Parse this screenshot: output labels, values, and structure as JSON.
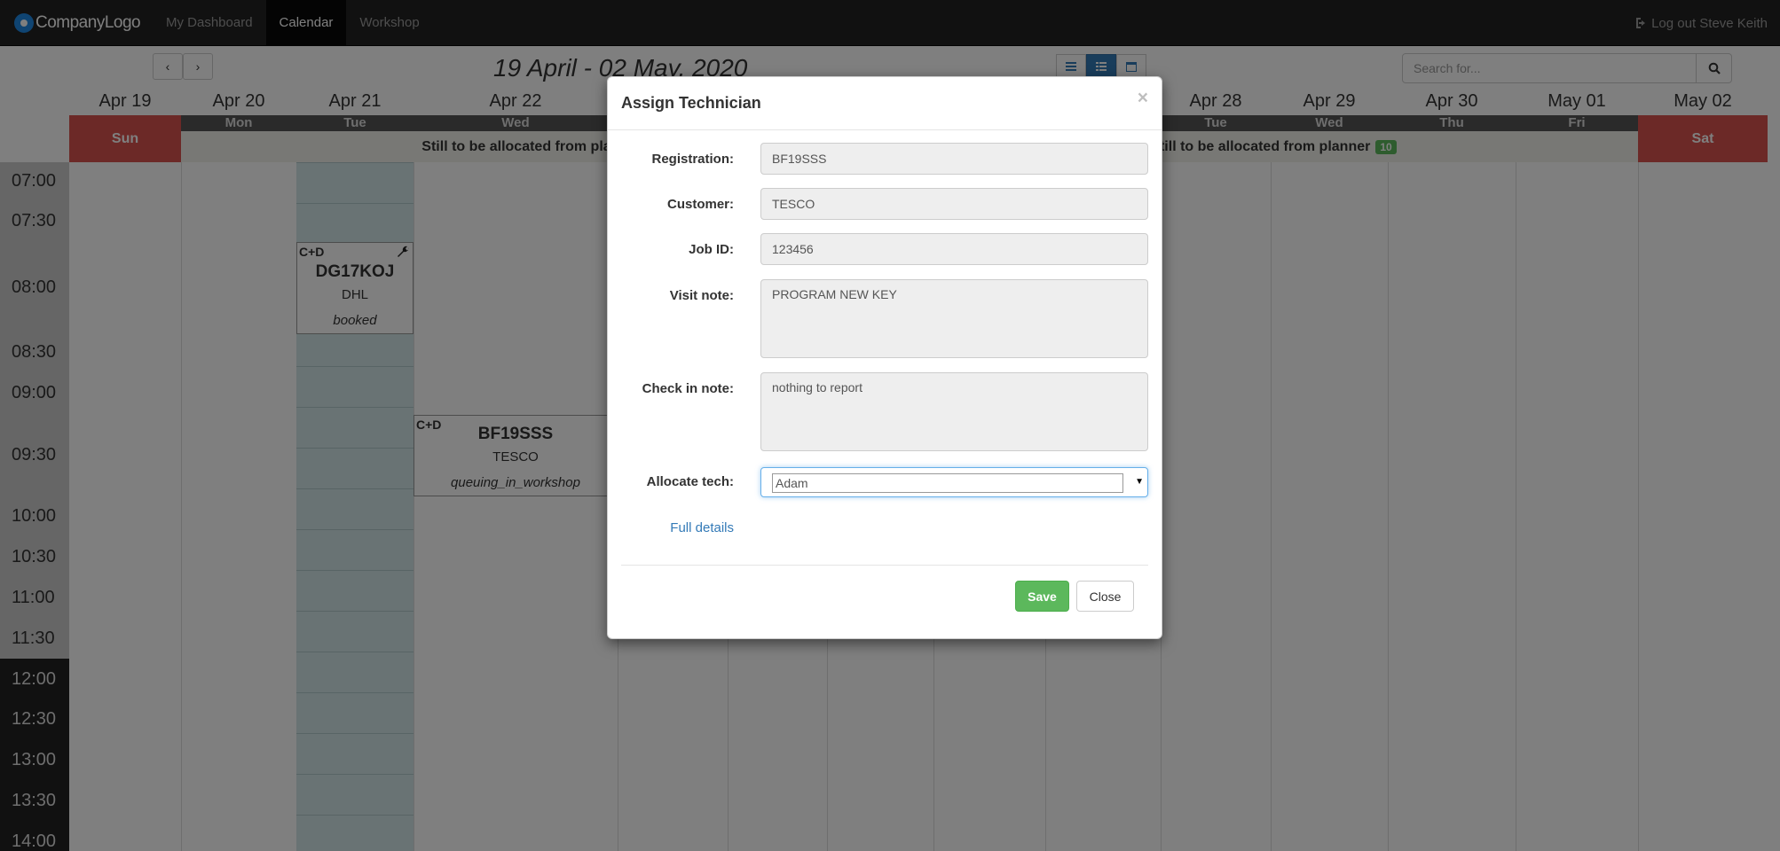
{
  "navbar": {
    "brand": "CompanyLogo",
    "items": [
      {
        "label": "My Dashboard",
        "active": false
      },
      {
        "label": "Calendar",
        "active": true
      },
      {
        "label": "Workshop",
        "active": false
      }
    ],
    "logout": "Log out Steve Keith"
  },
  "calendar": {
    "range_title": "19 April - 02 May, 2020",
    "search_placeholder": "Search for...",
    "days": [
      {
        "date": "Apr 19",
        "dow": "Sun"
      },
      {
        "date": "Apr 20",
        "dow": "Mon"
      },
      {
        "date": "Apr 21",
        "dow": "Tue"
      },
      {
        "date": "Apr 22",
        "dow": "Wed"
      },
      {
        "date": "Apr 28",
        "dow": "Tue"
      },
      {
        "date": "Apr 29",
        "dow": "Wed"
      },
      {
        "date": "Apr 30",
        "dow": "Thu"
      },
      {
        "date": "May 01",
        "dow": "Fri"
      },
      {
        "date": "May 02",
        "dow": "Sat"
      }
    ],
    "alloc_text": "Still to be allocated from planner",
    "alloc_count": "10",
    "times": [
      "07:00",
      "07:30",
      "08:00",
      "08:30",
      "09:00",
      "09:30",
      "10:00",
      "10:30",
      "11:00",
      "11:30",
      "12:00",
      "12:30",
      "13:00",
      "13:30",
      "14:00"
    ],
    "events": [
      {
        "tag": "C+D",
        "reg": "DG17KOJ",
        "customer": "DHL",
        "status": "booked"
      },
      {
        "tag": "C+D",
        "reg": "BF19SSS",
        "customer": "TESCO",
        "status": "queuing_in_workshop"
      }
    ]
  },
  "modal": {
    "title": "Assign Technician",
    "close_symbol": "×",
    "fields": {
      "registration_label": "Registration:",
      "registration_value": "BF19SSS",
      "customer_label": "Customer:",
      "customer_value": "TESCO",
      "job_label": "Job ID:",
      "job_value": "123456",
      "visit_label": "Visit note:",
      "visit_value": "PROGRAM NEW KEY",
      "checkin_label": "Check in note:",
      "checkin_value": "nothing to report",
      "alloc_label": "Allocate tech:",
      "alloc_value": "Adam"
    },
    "full_details": "Full details",
    "save": "Save",
    "close": "Close"
  }
}
